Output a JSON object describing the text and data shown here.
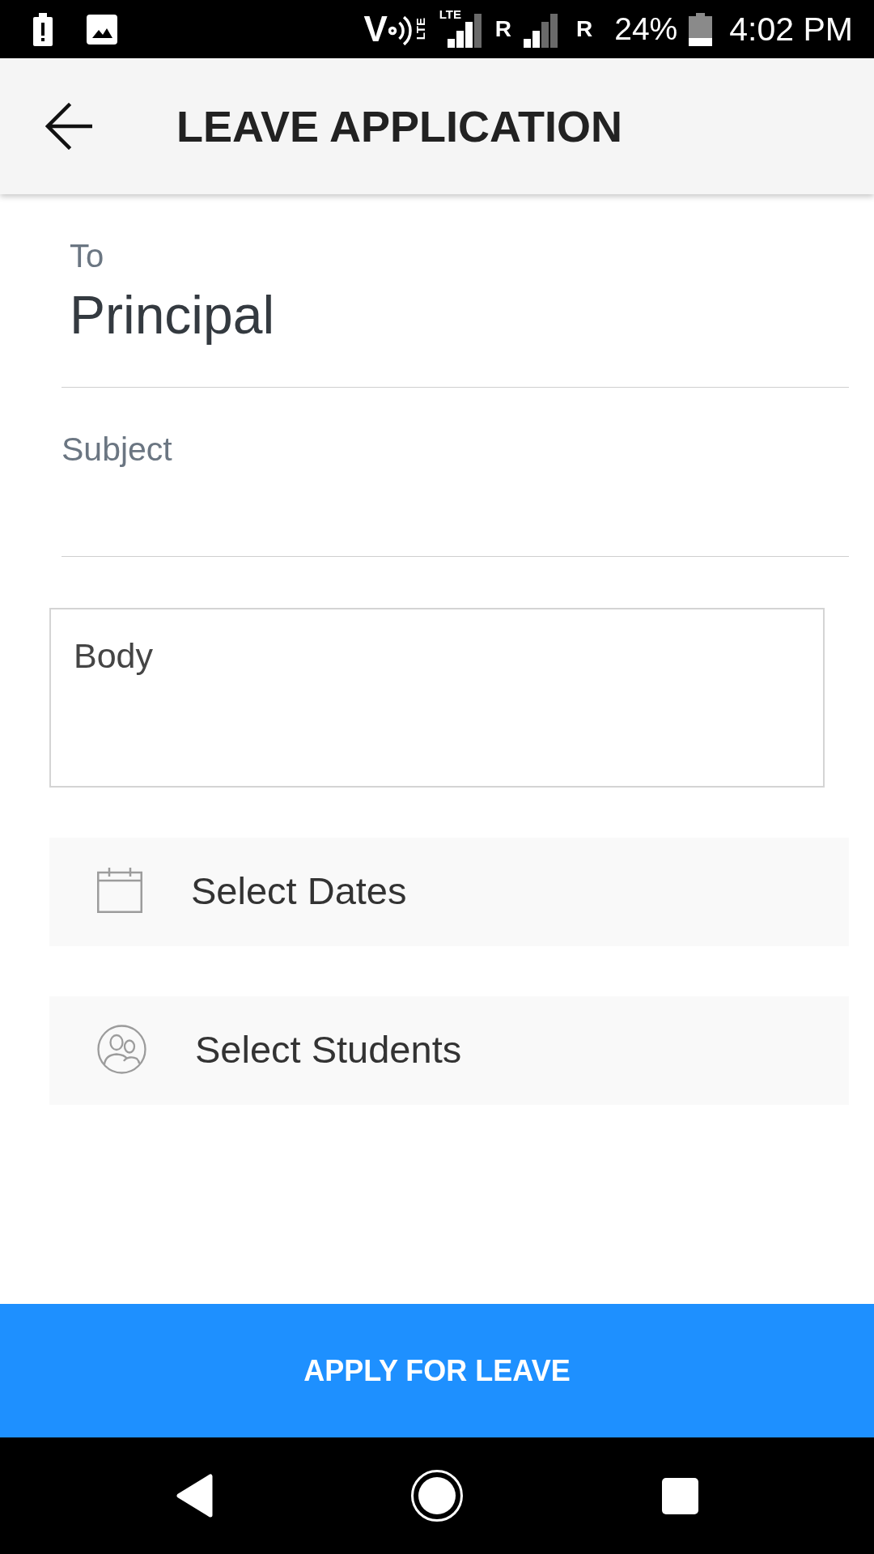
{
  "status_bar": {
    "calling": {
      "letter": "V",
      "network": "LTE"
    },
    "sims": [
      {
        "network": "LTE",
        "roaming": "R"
      },
      {
        "roaming": "R"
      }
    ],
    "battery": "24%",
    "time": "4:02 PM"
  },
  "app_bar": {
    "title": "LEAVE APPLICATION"
  },
  "form": {
    "to": {
      "label": "To",
      "value": "Principal"
    },
    "subject": {
      "placeholder": "Subject"
    },
    "body": {
      "placeholder": "Body"
    }
  },
  "pickers": [
    {
      "kind": "dates",
      "label": "Select Dates"
    },
    {
      "kind": "students",
      "label": "Select Students"
    }
  ],
  "submit_button": {
    "label": "APPLY FOR LEAVE"
  }
}
